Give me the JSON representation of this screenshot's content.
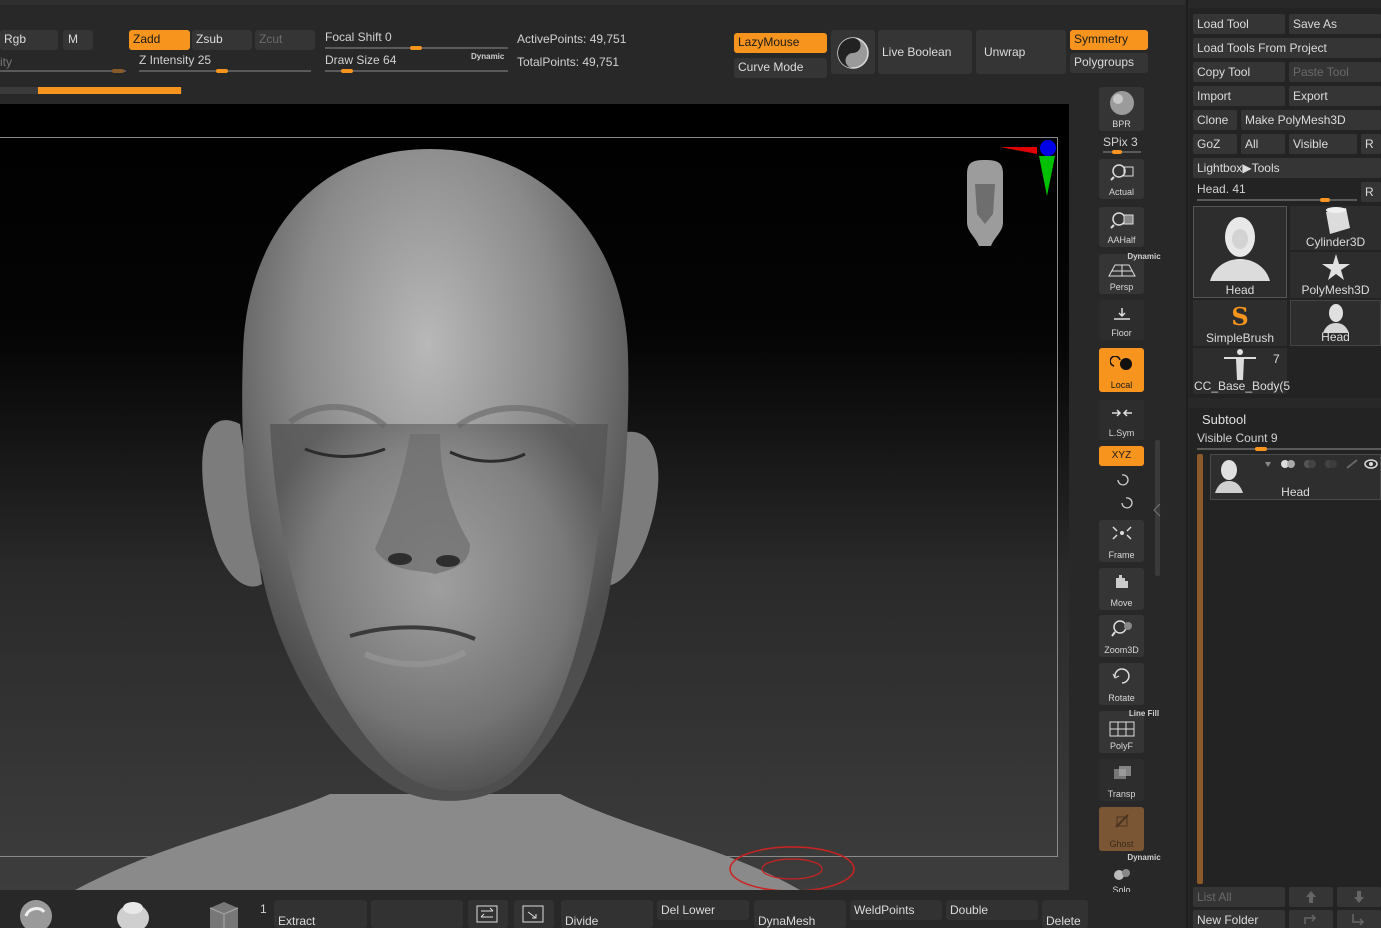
{
  "top": {
    "rgb": "Rgb",
    "m": "M",
    "intensity_partial": "ity",
    "zadd": "Zadd",
    "zsub": "Zsub",
    "zcut": "Zcut",
    "z_intensity_label": "Z Intensity",
    "z_intensity_value": "25",
    "focal_shift_label": "Focal Shift",
    "focal_shift_value": "0",
    "draw_size_label": "Draw Size",
    "draw_size_value": "64",
    "dynamic": "Dynamic",
    "active_points": "ActivePoints: 49,751",
    "total_points": "TotalPoints: 49,751",
    "lazymouse": "LazyMouse",
    "curve_mode": "Curve Mode",
    "live_boolean": "Live Boolean",
    "unwrap": "Unwrap",
    "symmetry": "Symmetry",
    "polygroups": "Polygroups"
  },
  "right_shelf": {
    "bpr": "BPR",
    "spix_label": "SPix",
    "spix_value": "3",
    "actual": "Actual",
    "aahalf": "AAHalf",
    "persp_dynamic": "Dynamic",
    "persp": "Persp",
    "floor": "Floor",
    "local": "Local",
    "lsym": "L.Sym",
    "xyz": "XYZ",
    "frame": "Frame",
    "move": "Move",
    "zoom3d": "Zoom3D",
    "rotate": "Rotate",
    "polyf_top": "Line Fill",
    "polyf": "PolyF",
    "transp": "Transp",
    "ghost": "Ghost",
    "solo_dynamic": "Dynamic",
    "solo": "Solo"
  },
  "tool_panel": {
    "load_tool": "Load Tool",
    "save_as": "Save As",
    "load_from_project": "Load Tools From Project",
    "copy_tool": "Copy Tool",
    "paste_tool": "Paste Tool",
    "import": "Import",
    "export": "Export",
    "clone": "Clone",
    "make_polymesh": "Make PolyMesh3D",
    "goz": "GoZ",
    "all": "All",
    "visible": "Visible",
    "r": "R",
    "lightbox_tools": "Lightbox▶Tools",
    "head_slider_label": "Head. 41",
    "r2": "R",
    "tools": [
      {
        "label": "Head"
      },
      {
        "label": "Cylinder3D"
      },
      {
        "label": "PolyMesh3D"
      },
      {
        "label": "SimpleBrush"
      },
      {
        "label": "Head"
      },
      {
        "label": "CC_Base_Body(5",
        "count": "7"
      }
    ]
  },
  "subtool": {
    "title": "Subtool",
    "visible_count_label": "Visible Count",
    "visible_count_value": "9",
    "item_label": "Head",
    "list_all": "List All",
    "new_folder": "New Folder"
  },
  "bottom": {
    "count": "1",
    "extract": "Extract",
    "divide": "Divide",
    "del_lower": "Del Lower",
    "dynamesh": "DynaMesh",
    "weldpoints": "WeldPoints",
    "double": "Double",
    "delete": "Delete"
  },
  "colors": {
    "accent": "#f7941d",
    "panel": "#353535",
    "background": "#282828"
  }
}
